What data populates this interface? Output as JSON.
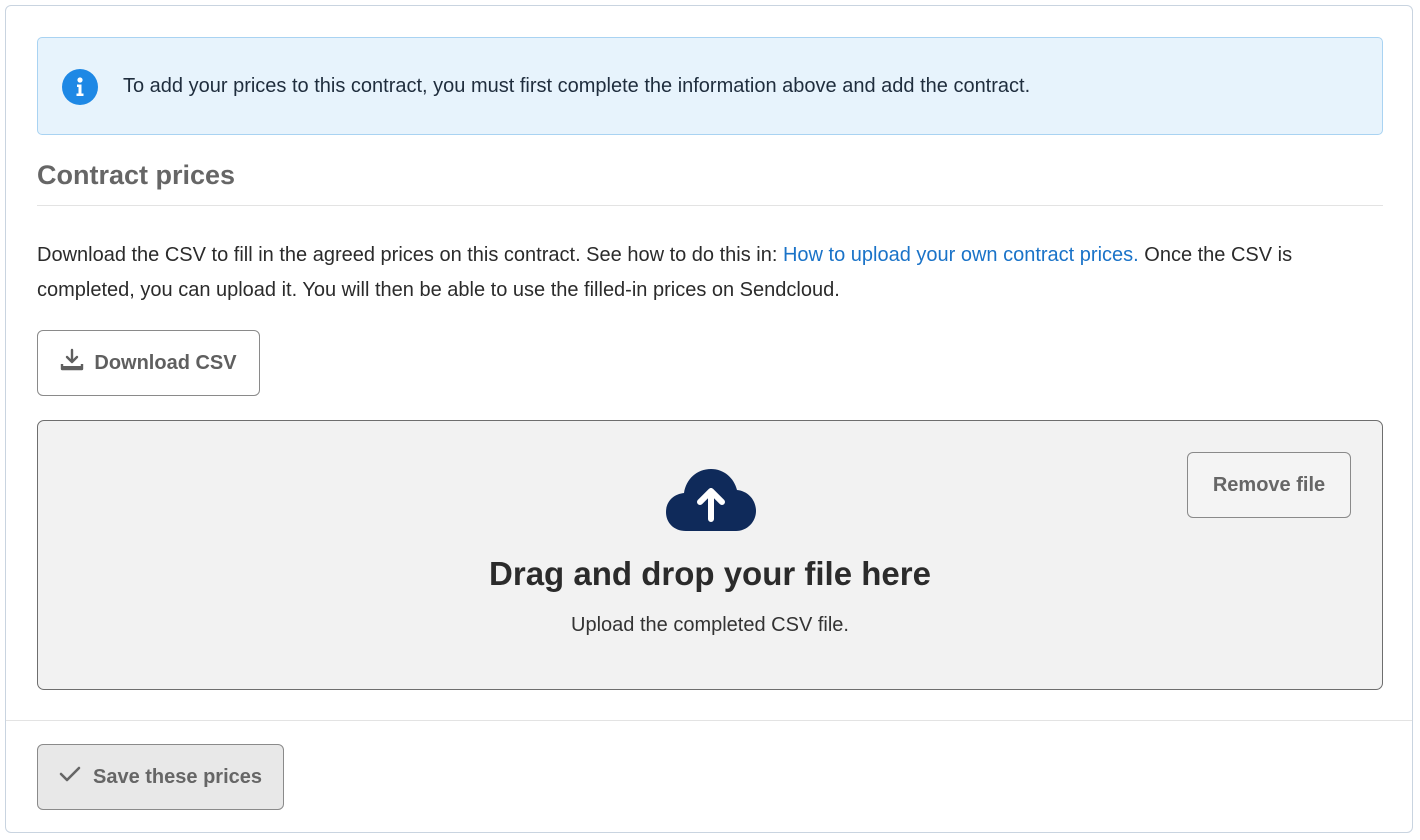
{
  "info_banner": {
    "icon": "info-icon",
    "text": "To add your prices to this contract, you must first complete the information above and add the contract."
  },
  "section": {
    "title": "Contract prices",
    "description_before": "Download the CSV to fill in the agreed prices on this contract. See how to do this in: ",
    "link_text": "How to upload your own contract prices.",
    "description_after": " Once the CSV is completed, you can upload it. You will then be able to use the filled-in prices on Sendcloud."
  },
  "download_button": {
    "label": "Download CSV",
    "icon": "download-icon"
  },
  "dropzone": {
    "icon": "cloud-upload-icon",
    "title": "Drag and drop your file here",
    "subtitle": "Upload the completed CSV file.",
    "remove_label": "Remove file"
  },
  "save_button": {
    "label": "Save these prices",
    "icon": "check-icon"
  },
  "colors": {
    "info_bg": "#e7f3fc",
    "info_border": "#a9d3f2",
    "info_icon": "#1e88e5",
    "link": "#1a73c8",
    "cloud": "#0f2a5a"
  }
}
